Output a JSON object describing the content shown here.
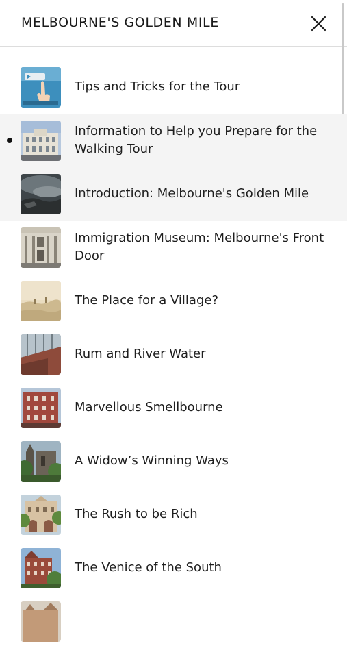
{
  "header": {
    "title": "MELBOURNE'S GOLDEN MILE"
  },
  "items": [
    {
      "label": "Tips and Tricks for the Tour",
      "thumb_icon": "tour-tips-image"
    },
    {
      "label": "Information to Help you Prepare for the Walking Tour",
      "thumb_icon": "building-image",
      "current": true
    },
    {
      "label": "Introduction: Melbourne's Golden Mile",
      "thumb_icon": "stormy-sky-image"
    },
    {
      "label": "Immigration Museum: Melbourne's Front Door",
      "thumb_icon": "museum-facade-image"
    },
    {
      "label": "The Place for a Village?",
      "thumb_icon": "sepia-landscape-image"
    },
    {
      "label": "Rum and River Water",
      "thumb_icon": "glass-building-image"
    },
    {
      "label": "Marvellous Smellbourne",
      "thumb_icon": "brick-building-image"
    },
    {
      "label": "A Widow’s Winning Ways",
      "thumb_icon": "church-garden-image"
    },
    {
      "label": "The Rush to be Rich",
      "thumb_icon": "heritage-building-image"
    },
    {
      "label": "The Venice of the South",
      "thumb_icon": "red-brick-tower-image"
    },
    {
      "label": "",
      "thumb_icon": "partial-building-image"
    }
  ],
  "colors": {
    "highlight": "#f4f4f4",
    "divider": "#dddddd",
    "text": "#1e1e1e"
  }
}
